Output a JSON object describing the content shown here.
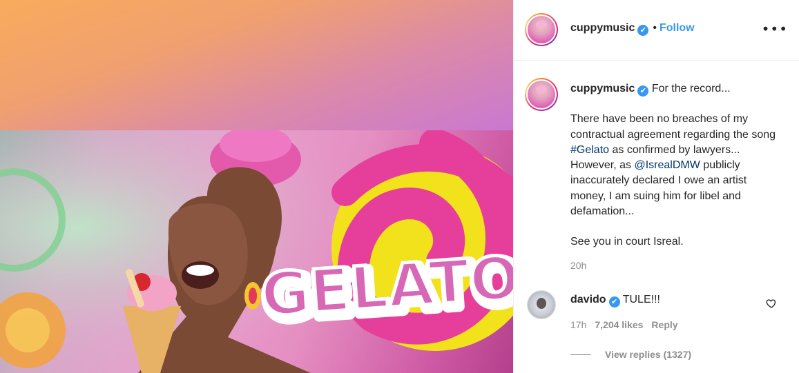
{
  "post": {
    "author": "cuppymusic",
    "follow_label": "Follow",
    "separator": "•",
    "more_glyph": "•••",
    "verified_glyph": "✔",
    "media_overlay_text": "GELATO"
  },
  "caption": {
    "username": "cuppymusic",
    "line1": "For the record...",
    "para1_a": "There have been no breaches of my contractual agreement regarding the song ",
    "hashtag": "#Gelato",
    "para1_b": " as confirmed by lawyers... However, as ",
    "mention": "@IsrealDMW",
    "para1_c": " publicly inaccurately declared I owe an artist money, I am suing him for libel and defamation...",
    "para2": "See you in court Isreal.",
    "time": "20h"
  },
  "comments": [
    {
      "username": "davido",
      "text": "TULE!!!",
      "time": "17h",
      "likes": "7,204 likes",
      "reply_label": "Reply",
      "view_replies": "View replies (1327)"
    }
  ],
  "colors": {
    "link_blue": "#3897f0",
    "tag_navy": "#003569",
    "muted_gray": "#8e8e8e",
    "text": "#262626"
  }
}
